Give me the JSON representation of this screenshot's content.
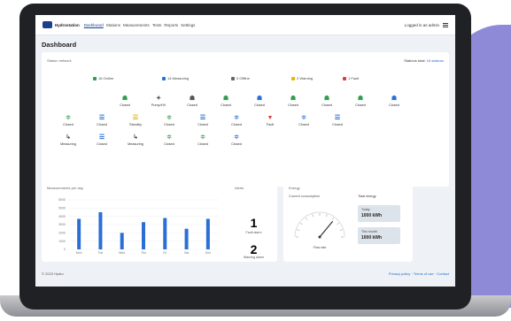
{
  "topbar": {
    "brand": "Hydrostation",
    "nav": [
      "Dashboard",
      "Stations",
      "Measurements",
      "Tests",
      "Reports",
      "Settings"
    ],
    "user": "Logged in as admin"
  },
  "page_title": "Dashboard",
  "stations_card": {
    "title": "Station network",
    "right_text": "Stations total:",
    "right_link": "18 stations",
    "legend": [
      {
        "label": "16 Online",
        "color": "#2e9e4f"
      },
      {
        "label": "14 Measuring",
        "color": "#2a6fd6"
      },
      {
        "label": "0 Offline",
        "color": "#666666"
      },
      {
        "label": "2 Warning",
        "color": "#e8b400"
      },
      {
        "label": "1 Fault",
        "color": "#e03a3a"
      }
    ],
    "stations": [
      {
        "label": "Closed",
        "glyph": "☗",
        "color": "#2e9e4f"
      },
      {
        "label": "Pump/HV",
        "glyph": "✦",
        "color": "#555555"
      },
      {
        "label": "Closed",
        "glyph": "☗",
        "color": "#555555"
      },
      {
        "label": "Closed",
        "glyph": "☗",
        "color": "#2e9e4f"
      },
      {
        "label": "Closed",
        "glyph": "☗",
        "color": "#2a6fd6"
      },
      {
        "label": "Closed",
        "glyph": "☗",
        "color": "#2e9e4f"
      },
      {
        "label": "Closed",
        "glyph": "☗",
        "color": "#2e9e4f"
      },
      {
        "label": "Closed",
        "glyph": "☗",
        "color": "#2e9e4f"
      },
      {
        "label": "Closed",
        "glyph": "☗",
        "color": "#2a6fd6"
      },
      {
        "label": "Closed",
        "glyph": "≑",
        "color": "#2e9e4f"
      },
      {
        "label": "Closed",
        "glyph": "☰",
        "color": "#2a6fd6"
      },
      {
        "label": "Standby",
        "glyph": "☰",
        "color": "#e8b400"
      },
      {
        "label": "Closed",
        "glyph": "≑",
        "color": "#2e9e4f"
      },
      {
        "label": "Closed",
        "glyph": "☰",
        "color": "#2a6fd6"
      },
      {
        "label": "Closed",
        "glyph": "≑",
        "color": "#2a6fd6"
      },
      {
        "label": "Fault",
        "glyph": "▼",
        "color": "#e03a3a"
      },
      {
        "label": "Closed",
        "glyph": "≑",
        "color": "#2a6fd6"
      },
      {
        "label": "Closed",
        "glyph": "☰",
        "color": "#2a6fd6"
      },
      {
        "label": "Measuring",
        "glyph": "↳",
        "color": "#555555"
      },
      {
        "label": "Closed",
        "glyph": "☰",
        "color": "#2a6fd6"
      },
      {
        "label": "Measuring",
        "glyph": "↳",
        "color": "#555555"
      },
      {
        "label": "Closed",
        "glyph": "≑",
        "color": "#2e9e4f"
      },
      {
        "label": "Closed",
        "glyph": "≑",
        "color": "#2e9e4f"
      },
      {
        "label": "Closed",
        "glyph": "≑",
        "color": "#2a6fd6"
      }
    ]
  },
  "chart_card": {
    "title": "Measurements per day",
    "range": "Last 7 days"
  },
  "chart_data": {
    "type": "bar",
    "categories": [
      "Mon",
      "Tue",
      "Wed",
      "Thu",
      "Fri",
      "Sat",
      "Sun"
    ],
    "values": [
      3700,
      4500,
      2000,
      3300,
      3800,
      2500,
      3700
    ],
    "ylim": [
      0,
      6000
    ],
    "yticks": [
      0,
      1000,
      2000,
      3000,
      4000,
      5000,
      6000
    ],
    "color": "#2a6fd6"
  },
  "alerts_card": {
    "title": "Alerts",
    "items": [
      {
        "value": "1",
        "label": "Fault alarm",
        "color": "#e03a3a"
      },
      {
        "value": "2",
        "label": "Warning alarm",
        "color": "#2e9e4f"
      }
    ]
  },
  "gauge_card": {
    "title": "Energy",
    "subtitle": "Current consumption",
    "gauge_label": "Flow rate",
    "gauge_value_fraction": 0.72,
    "totals_title": "Total energy",
    "stats": [
      {
        "label": "Today",
        "value": "1000 kWh"
      },
      {
        "label": "This month",
        "value": "1000 kWh"
      }
    ]
  },
  "footer": {
    "left": "© 2023 Hydro",
    "right": "Privacy policy · Terms of use · Contact"
  }
}
